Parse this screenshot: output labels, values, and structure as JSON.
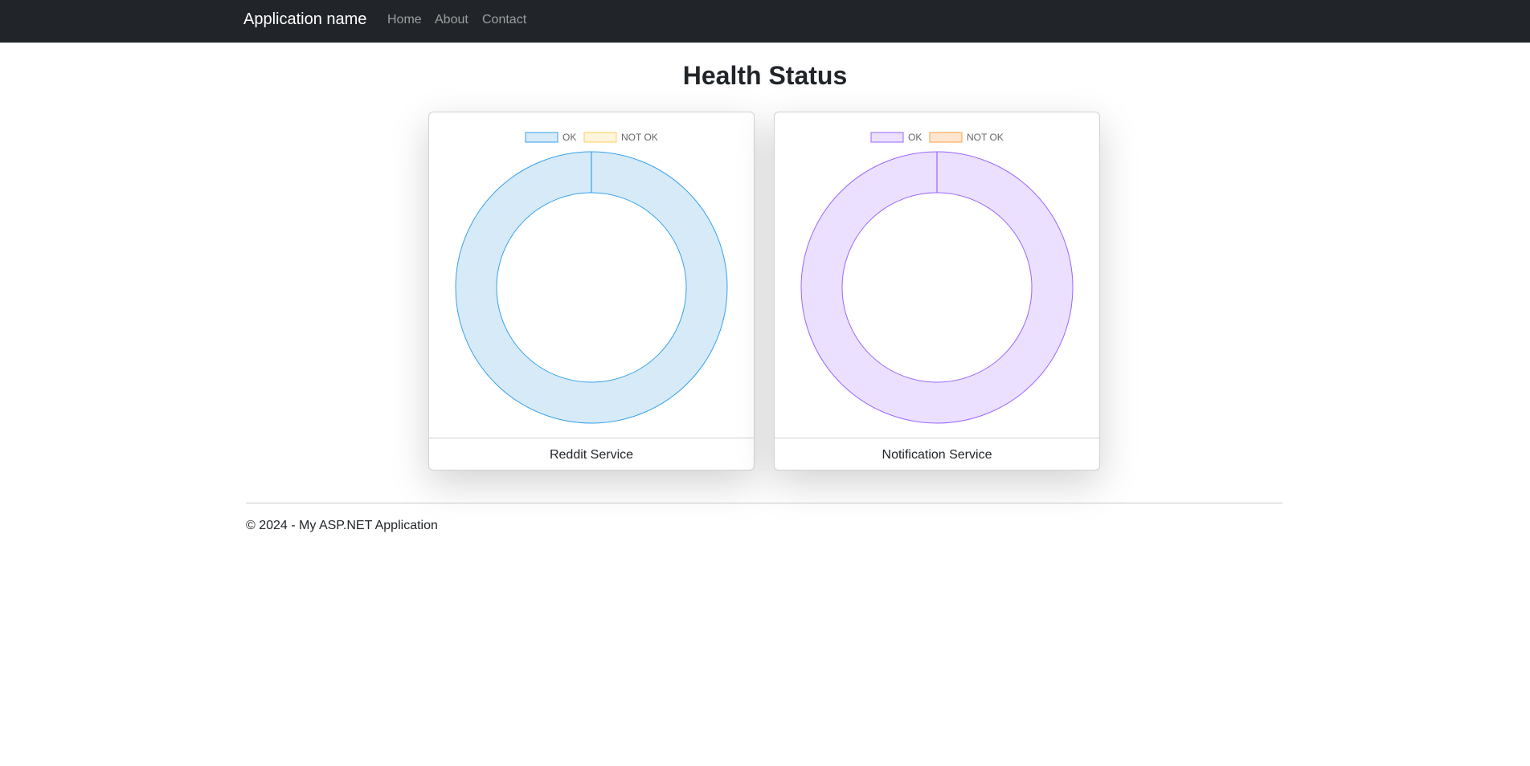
{
  "navbar": {
    "brand": "Application name",
    "links": [
      {
        "label": "Home"
      },
      {
        "label": "About"
      },
      {
        "label": "Contact"
      }
    ]
  },
  "page": {
    "title": "Health Status"
  },
  "services": [
    {
      "name": "Reddit Service",
      "legend": {
        "ok": "OK",
        "not_ok": "NOT OK"
      },
      "colors": {
        "ok_fill": "#d7eaf8",
        "ok_stroke": "#36a2eb",
        "not_ok_fill": "#fff5dd",
        "not_ok_stroke": "#ffce56"
      }
    },
    {
      "name": "Notification Service",
      "legend": {
        "ok": "OK",
        "not_ok": "NOT OK"
      },
      "colors": {
        "ok_fill": "#ebe0ff",
        "ok_stroke": "#9966ff",
        "not_ok_fill": "#ffe6d0",
        "not_ok_stroke": "#ff9f40"
      }
    }
  ],
  "chart_data": [
    {
      "type": "pie",
      "categories": [
        "OK",
        "NOT OK"
      ],
      "values": [
        1,
        0
      ],
      "legend": "top",
      "subtitle": "Reddit Service"
    },
    {
      "type": "pie",
      "categories": [
        "OK",
        "NOT OK"
      ],
      "values": [
        1,
        0
      ],
      "legend": "top",
      "subtitle": "Notification Service"
    }
  ],
  "footer": {
    "text": "© 2024 - My ASP.NET Application"
  }
}
